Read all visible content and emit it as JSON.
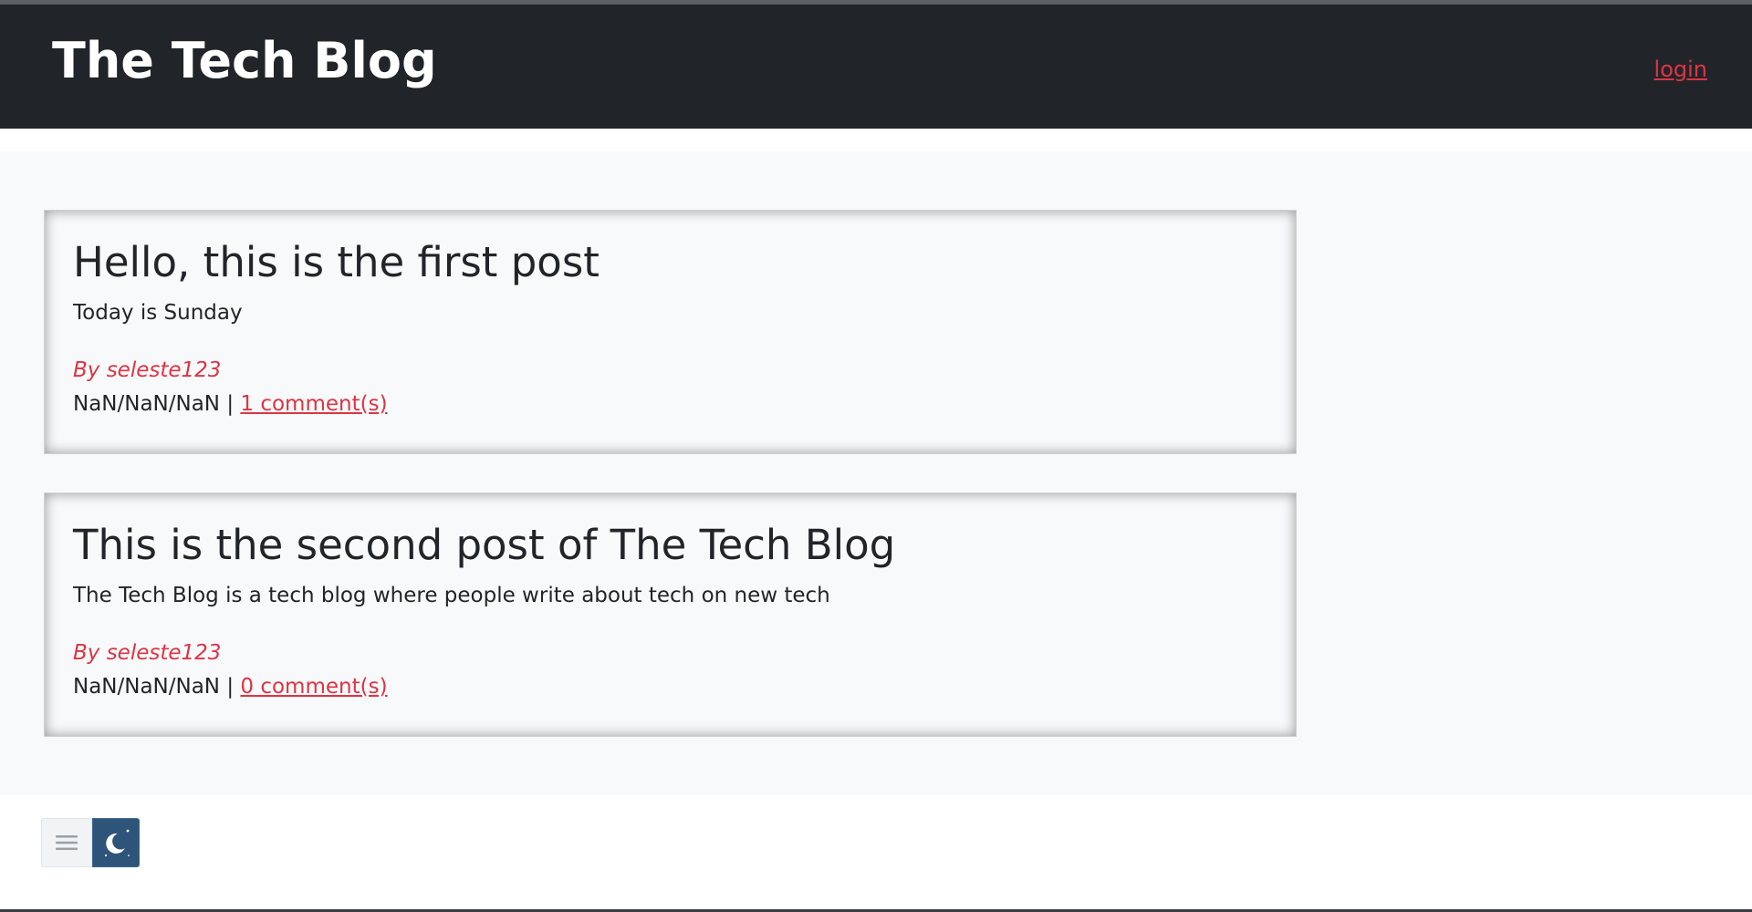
{
  "header": {
    "site_title": "The Tech Blog",
    "login_label": "login"
  },
  "posts": [
    {
      "title": "Hello, this is the first post",
      "body": "Today is Sunday",
      "author": "By seleste123",
      "date": "NaN/NaN/NaN",
      "separator": "|",
      "comments_label": "1 comment(s)"
    },
    {
      "title": "This is the second post of The Tech Blog",
      "body": "The Tech Blog is a tech blog where people write about tech on new tech",
      "author": "By seleste123",
      "date": "NaN/NaN/NaN",
      "separator": "|",
      "comments_label": "0 comment(s)"
    }
  ],
  "toolbar": {
    "menu_icon": "hamburger-icon",
    "theme_icon": "moon-icon"
  },
  "colors": {
    "header_bg": "#212529",
    "accent": "#dc3545",
    "main_bg": "#f8f9fa",
    "theme_toggle_bg": "#2f5479"
  }
}
